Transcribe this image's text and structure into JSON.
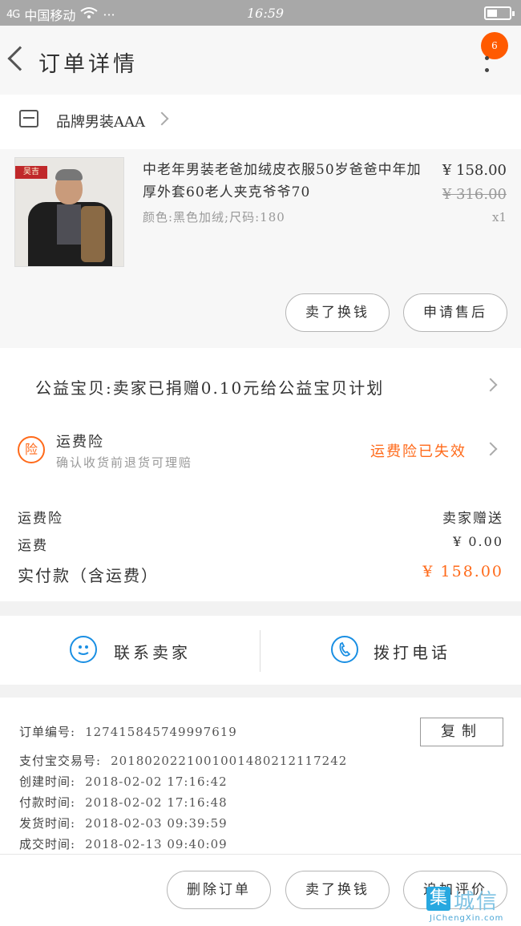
{
  "status_bar": {
    "carrier": "中国移动",
    "signal": "4G",
    "dots": "···",
    "time": "16:59"
  },
  "header": {
    "title": "订单详情",
    "badge_count": "6"
  },
  "shop": {
    "name": "品牌男装AAA"
  },
  "product": {
    "thumb_tag": "吴吉",
    "title": "中老年男装老爸加绒皮衣服50岁爸爸中年加厚外套60老人夹克爷爷70",
    "spec": "颜色:黑色加绒;尺码:180",
    "price": "¥ 158.00",
    "original_price": "¥ 316.00",
    "quantity": "x1",
    "buttons": [
      "卖了换钱",
      "申请售后"
    ]
  },
  "charity": {
    "text": "公益宝贝:卖家已捐赠0.10元给公益宝贝计划"
  },
  "insurance": {
    "icon": "险",
    "title": "运费险",
    "subtitle": "确认收货前退货可理赔",
    "status": "运费险已失效"
  },
  "fees": [
    {
      "label": "运费险",
      "value": "卖家赠送"
    },
    {
      "label": "运费",
      "value": "¥ 0.00"
    },
    {
      "label": "实付款（含运费）",
      "value": "¥ 158.00"
    }
  ],
  "contact": {
    "seller": "联系卖家",
    "call": "拨打电话"
  },
  "order_info": {
    "copy_label": "复制",
    "rows": [
      {
        "label": "订单编号:",
        "value": "127415845749997619"
      },
      {
        "label": "支付宝交易号:",
        "value": "2018020221001001480212117242"
      },
      {
        "label": "创建时间:",
        "value": "2018-02-02 17:16:42"
      },
      {
        "label": "付款时间:",
        "value": "2018-02-02 17:16:48"
      },
      {
        "label": "发货时间:",
        "value": "2018-02-03 09:39:59"
      },
      {
        "label": "成交时间:",
        "value": "2018-02-13 09:40:09"
      }
    ]
  },
  "bottom_actions": [
    "删除订单",
    "卖了换钱",
    "追加评价"
  ],
  "watermark": {
    "box": "集",
    "text": "城信",
    "sub": "JiChengXin.com"
  },
  "colors": {
    "accent": "#ff6a1a",
    "blue": "#1a8fe3",
    "badge": "#ff5a00"
  }
}
